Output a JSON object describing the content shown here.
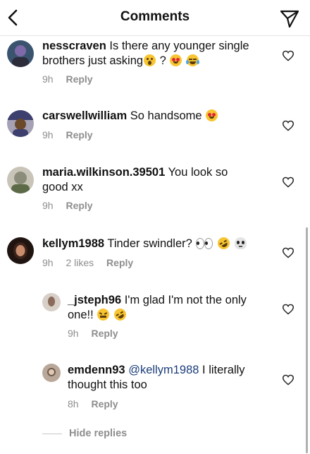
{
  "header": {
    "title": "Comments"
  },
  "comments": [
    {
      "username": "nesscraven",
      "text": "Is there any younger single brothers just asking",
      "after_text": "?",
      "time": "9h",
      "likes": "",
      "reply_label": "Reply",
      "avatar_colors": [
        "#3a5470",
        "#7e6aa8",
        "#2c2c3a"
      ]
    },
    {
      "username": "carswellwilliam",
      "text": "So handsome",
      "time": "9h",
      "likes": "",
      "reply_label": "Reply",
      "avatar_colors": [
        "#6b4a2b",
        "#a6a2b5",
        "#3d3f6e"
      ]
    },
    {
      "username": "maria.wilkinson.39501",
      "text": "You look so good xx",
      "time": "9h",
      "likes": "",
      "reply_label": "Reply",
      "avatar_colors": [
        "#8c8c7a",
        "#5c6a48",
        "#c9c4b8"
      ]
    },
    {
      "username": "kellym1988",
      "text": "Tinder swindler?",
      "time": "9h",
      "likes": "2 likes",
      "reply_label": "Reply",
      "avatar_colors": [
        "#3b241a",
        "#c98d6e",
        "#1f1410"
      ]
    }
  ],
  "replies": [
    {
      "username": "_jsteph96",
      "text": "I'm glad I'm not the only one!!",
      "time": "9h",
      "reply_label": "Reply",
      "avatar_colors": [
        "#d7cfc8",
        "#8a6a5a"
      ]
    },
    {
      "username": "emdenn93",
      "mention": "@kellym1988",
      "text": "I literally thought this too",
      "time": "8h",
      "reply_label": "Reply",
      "avatar_colors": [
        "#b9a89a",
        "#6e5a4c"
      ]
    }
  ],
  "hide_replies_label": "Hide replies",
  "icons": {
    "back": "chevron-left-icon",
    "send": "paper-plane-icon",
    "like": "heart-outline-icon"
  },
  "colors": {
    "text": "#111111",
    "meta": "#8e8e8e",
    "mention": "#1a3c7a"
  }
}
